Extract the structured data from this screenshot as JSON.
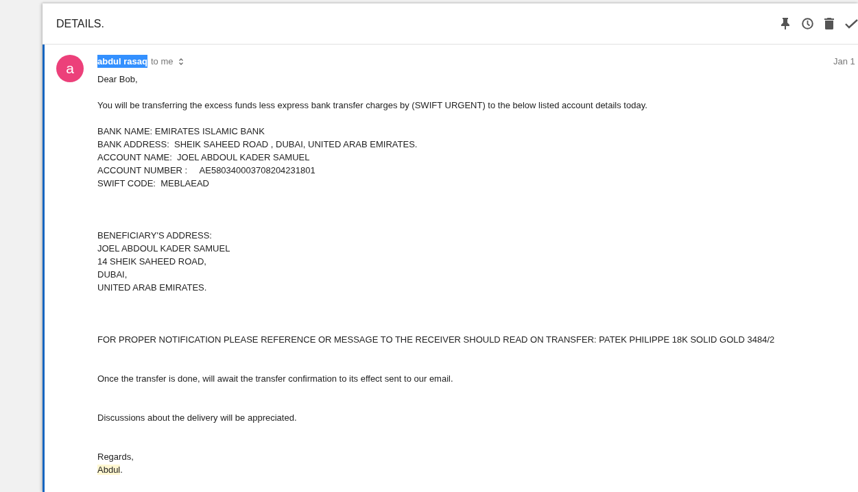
{
  "header": {
    "title": "DETAILS."
  },
  "message": {
    "avatar": {
      "letter": "a"
    },
    "sender": {
      "name": "abdul rasaq",
      "highlighted": true
    },
    "recipient": "to me",
    "date": "Jan 1",
    "body": "Dear Bob,\n\nYou will be transferring the excess funds less express bank transfer charges by (SWIFT URGENT) to the below listed account details today.\n\nBANK NAME: EMIRATES ISLAMIC BANK\nBANK ADDRESS:  SHEIK SAHEED ROAD , DUBAI, UNITED ARAB EMIRATES.\nACCOUNT NAME:  JOEL ABDOUL KADER SAMUEL\nACCOUNT NUMBER :     AE580340003708204231801\nSWIFT CODE:  MEBLAEAD\n\n\n\nBENEFICIARY'S ADDRESS:\nJOEL ABDOUL KADER SAMUEL\n14 SHEIK SAHEED ROAD,\nDUBAI,\nUNITED ARAB EMIRATES.\n\n\n\nFOR PROPER NOTIFICATION PLEASE REFERENCE OR MESSAGE TO THE RECEIVER SHOULD READ ON TRANSFER: PATEK PHILIPPE 18K SOLID GOLD 3484/2\n\n\nOnce the transfer is done, will await the transfer confirmation to its effect sent to our email.\n\n\nDiscussions about the delivery will be appreciated.\n\n\nRegards,",
    "signature": {
      "name": "Abdul",
      "highlighted": true,
      "punctuation": "."
    }
  }
}
